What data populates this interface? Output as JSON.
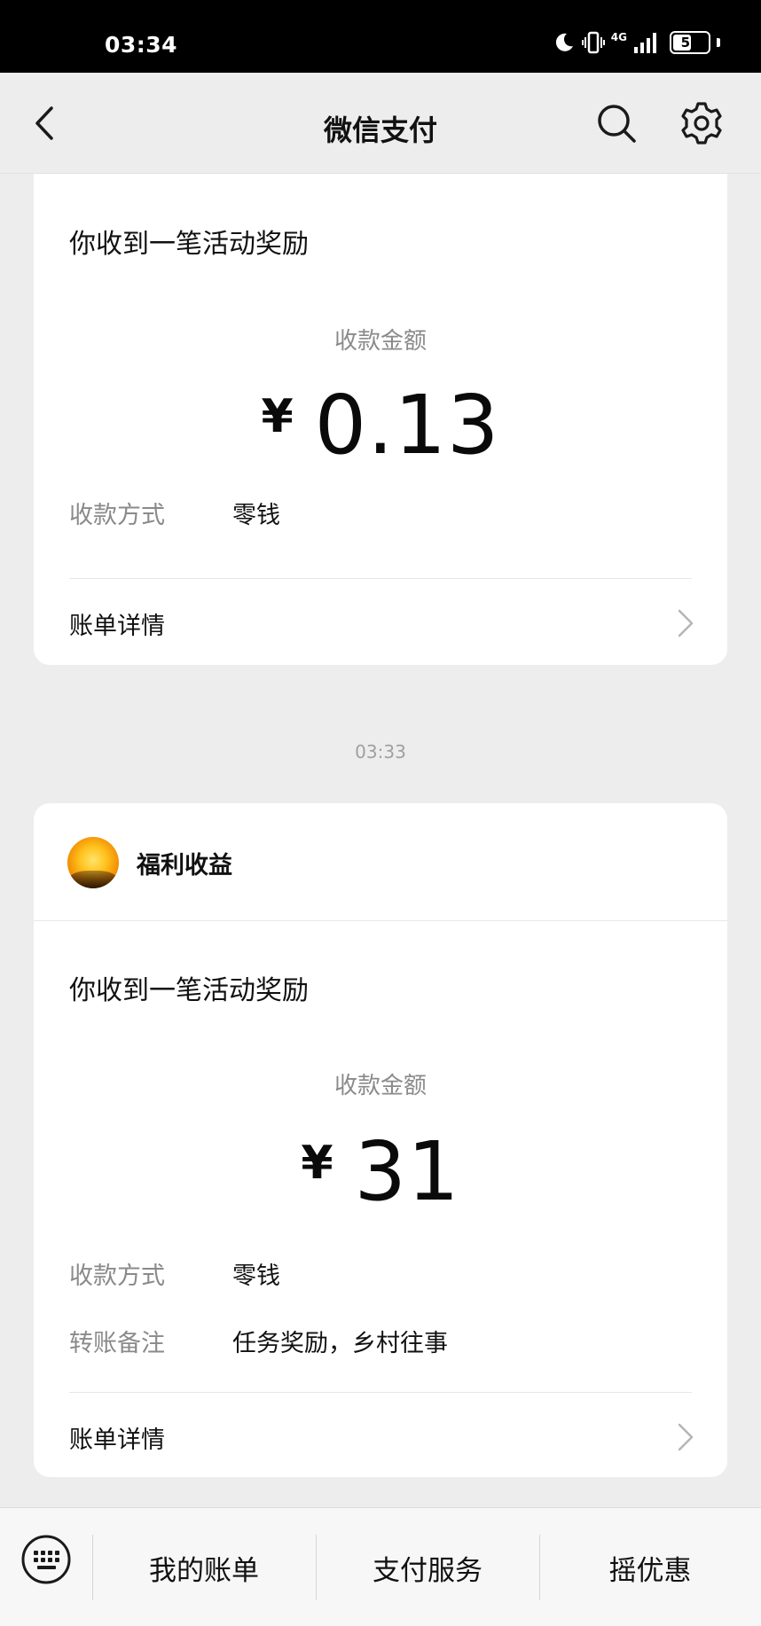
{
  "status_bar": {
    "time": "03:34",
    "network": "4G",
    "battery": "52",
    "battery_level": 0.52
  },
  "nav": {
    "title": "微信支付",
    "back_icon": "chevron-left-icon",
    "search_icon": "search-icon",
    "settings_icon": "gear-icon"
  },
  "messages": [
    {
      "heading": "你收到一笔活动奖励",
      "amount_label": "收款金额",
      "currency": "¥",
      "amount": "0.13",
      "fields": [
        {
          "label": "收款方式",
          "value": "零钱"
        }
      ],
      "bill_detail": "账单详情"
    },
    {
      "timestamp": "03:33",
      "sender": "福利收益",
      "heading": "你收到一笔活动奖励",
      "amount_label": "收款金额",
      "currency": "¥",
      "amount": "31",
      "fields": [
        {
          "label": "收款方式",
          "value": "零钱"
        },
        {
          "label": "转账备注",
          "value": "任务奖励，乡村往事"
        }
      ],
      "bill_detail": "账单详情"
    }
  ],
  "bottom_menu": {
    "keyboard_icon": "keyboard-icon",
    "items": [
      "我的账单",
      "支付服务",
      "摇优惠"
    ]
  }
}
